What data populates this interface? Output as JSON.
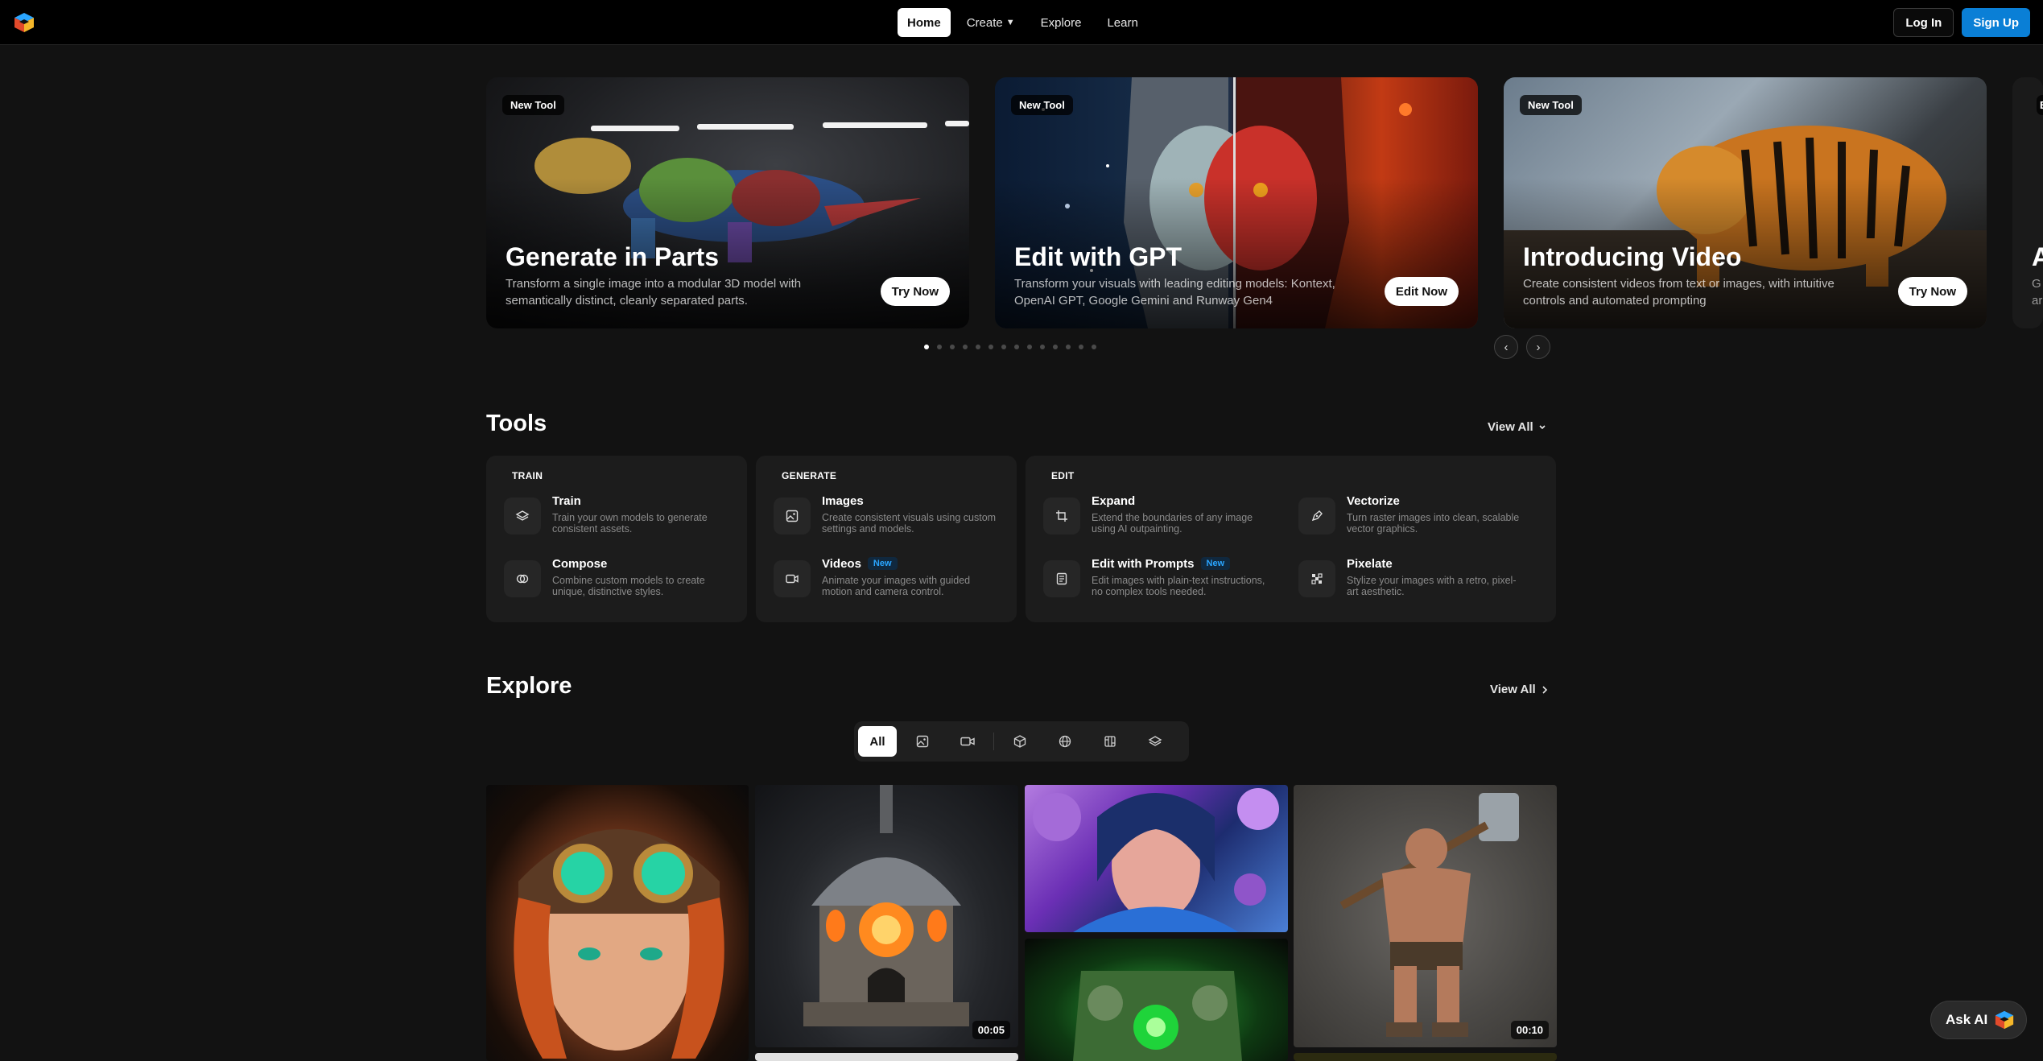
{
  "nav": {
    "links": [
      {
        "label": "Home",
        "active": true
      },
      {
        "label": "Create",
        "has_dropdown": true
      },
      {
        "label": "Explore"
      },
      {
        "label": "Learn"
      }
    ],
    "login": "Log In",
    "signup": "Sign Up"
  },
  "hero": {
    "cards": [
      {
        "pill": "New Tool",
        "title": "Generate in Parts",
        "desc": "Transform a single image into a modular 3D model with semantically distinct, cleanly separated parts.",
        "button": "Try Now"
      },
      {
        "pill": "New Tool",
        "title": "Edit with GPT",
        "desc": "Transform your visuals with leading editing models: Kontext, OpenAI GPT, Google Gemini and Runway Gen4",
        "button": "Edit Now"
      },
      {
        "pill": "New Tool",
        "title": "Introducing Video",
        "desc": "Create consistent videos from text or images, with intuitive controls and automated prompting",
        "button": "Try Now"
      }
    ],
    "peek_title": "A",
    "peek_desc": "G ar",
    "peek_pill": "E",
    "slide_count": 14,
    "active_slide": 0
  },
  "tools": {
    "title": "Tools",
    "view_all": "View All",
    "groups": [
      {
        "label": "TRAIN",
        "items": [
          {
            "name": "Train",
            "desc": "Train your own models to generate consistent assets.",
            "icon": "layers-icon"
          },
          {
            "name": "Compose",
            "desc": "Combine custom models to create unique, distinctive styles.",
            "icon": "compose-icon"
          }
        ]
      },
      {
        "label": "GENERATE",
        "items": [
          {
            "name": "Images",
            "desc": "Create consistent visuals using custom settings and models.",
            "icon": "image-icon"
          },
          {
            "name": "Videos",
            "desc": "Animate your images with guided motion and camera control.",
            "icon": "video-icon",
            "badge": "New"
          }
        ]
      },
      {
        "label": "EDIT",
        "items": [
          {
            "name": "Expand",
            "desc": "Extend the boundaries of any image using AI outpainting.",
            "icon": "crop-icon"
          },
          {
            "name": "Vectorize",
            "desc": "Turn raster images into clean, scalable vector graphics.",
            "icon": "pen-icon"
          },
          {
            "name": "Edit with Prompts",
            "desc": "Edit images with plain-text instructions, no complex tools needed.",
            "icon": "document-icon",
            "badge": "New"
          },
          {
            "name": "Pixelate",
            "desc": "Stylize your images with a retro, pixel-art aesthetic.",
            "icon": "pixel-icon"
          }
        ]
      }
    ]
  },
  "explore": {
    "title": "Explore",
    "view_all": "View All",
    "filters": [
      {
        "label": "All",
        "active": true
      },
      {
        "icon": "image-icon"
      },
      {
        "icon": "video-icon"
      },
      {
        "icon": "cube-icon"
      },
      {
        "icon": "globe-icon"
      },
      {
        "icon": "texture-icon"
      },
      {
        "icon": "layers-icon"
      }
    ],
    "tiles": [
      {
        "duration": ""
      },
      {
        "duration": "00:05"
      },
      {
        "duration": ""
      },
      {
        "duration": ""
      },
      {
        "duration": "00:10"
      }
    ]
  },
  "ask_ai": "Ask AI",
  "colors": {
    "accent": "#0a7fd6",
    "badge": "#2aa5ff",
    "background": "#121212"
  }
}
